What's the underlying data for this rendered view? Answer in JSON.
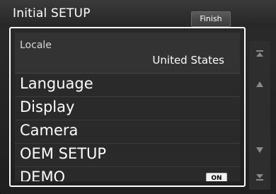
{
  "header": {
    "title": "Initial SETUP",
    "finish_label": "Finish"
  },
  "list": {
    "locale": {
      "label": "Locale",
      "value": "United States"
    },
    "items": [
      {
        "label": "Language"
      },
      {
        "label": "Display"
      },
      {
        "label": "Camera"
      },
      {
        "label": "OEM SETUP"
      },
      {
        "label": "DEMO",
        "toggle": "ON"
      }
    ]
  },
  "scroll": {
    "icons": [
      "scroll-top-icon",
      "scroll-up-icon",
      "scroll-down-icon",
      "scroll-bottom-icon"
    ]
  },
  "colors": {
    "frame": "#ffffff",
    "background": "#2a2a2a",
    "text": "#ffffff"
  }
}
